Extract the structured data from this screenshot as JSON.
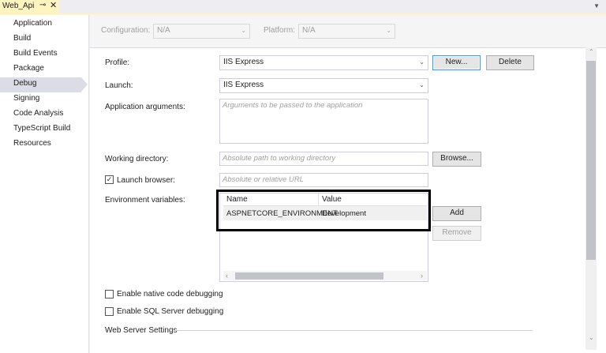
{
  "tab": {
    "title": "Web_Api",
    "pin_icon": "pin-icon",
    "close_icon": "close-icon",
    "menu_icon": "dropdown-icon"
  },
  "nav": {
    "items": [
      {
        "label": "Application"
      },
      {
        "label": "Build"
      },
      {
        "label": "Build Events"
      },
      {
        "label": "Package"
      },
      {
        "label": "Debug",
        "selected": true
      },
      {
        "label": "Signing"
      },
      {
        "label": "Code Analysis"
      },
      {
        "label": "TypeScript Build"
      },
      {
        "label": "Resources"
      }
    ]
  },
  "config": {
    "configuration_label": "Configuration:",
    "configuration_value": "N/A",
    "platform_label": "Platform:",
    "platform_value": "N/A"
  },
  "form": {
    "profile_label": "Profile:",
    "profile_value": "IIS Express",
    "new_button": "New...",
    "delete_button": "Delete",
    "launch_label": "Launch:",
    "launch_value": "IIS Express",
    "app_args_label": "Application arguments:",
    "app_args_placeholder": "Arguments to be passed to the application",
    "working_dir_label": "Working directory:",
    "working_dir_placeholder": "Absolute path to working directory",
    "browse_button": "Browse...",
    "launch_browser_label": "Launch browser:",
    "launch_browser_checked": true,
    "launch_browser_placeholder": "Absolute or relative URL",
    "env_label": "Environment variables:",
    "add_button": "Add",
    "remove_button": "Remove",
    "native_debug_label": "Enable native code debugging",
    "sql_debug_label": "Enable SQL Server debugging",
    "web_server_label": "Web Server Settings"
  },
  "env_table": {
    "columns": [
      "Name",
      "Value"
    ],
    "rows": [
      {
        "name": "ASPNETCORE_ENVIRONMENT",
        "value": "Development"
      }
    ]
  },
  "colors": {
    "tab_accent": "#fdf4bf",
    "selection": "#dcdce6",
    "focus": "#3399ff"
  }
}
